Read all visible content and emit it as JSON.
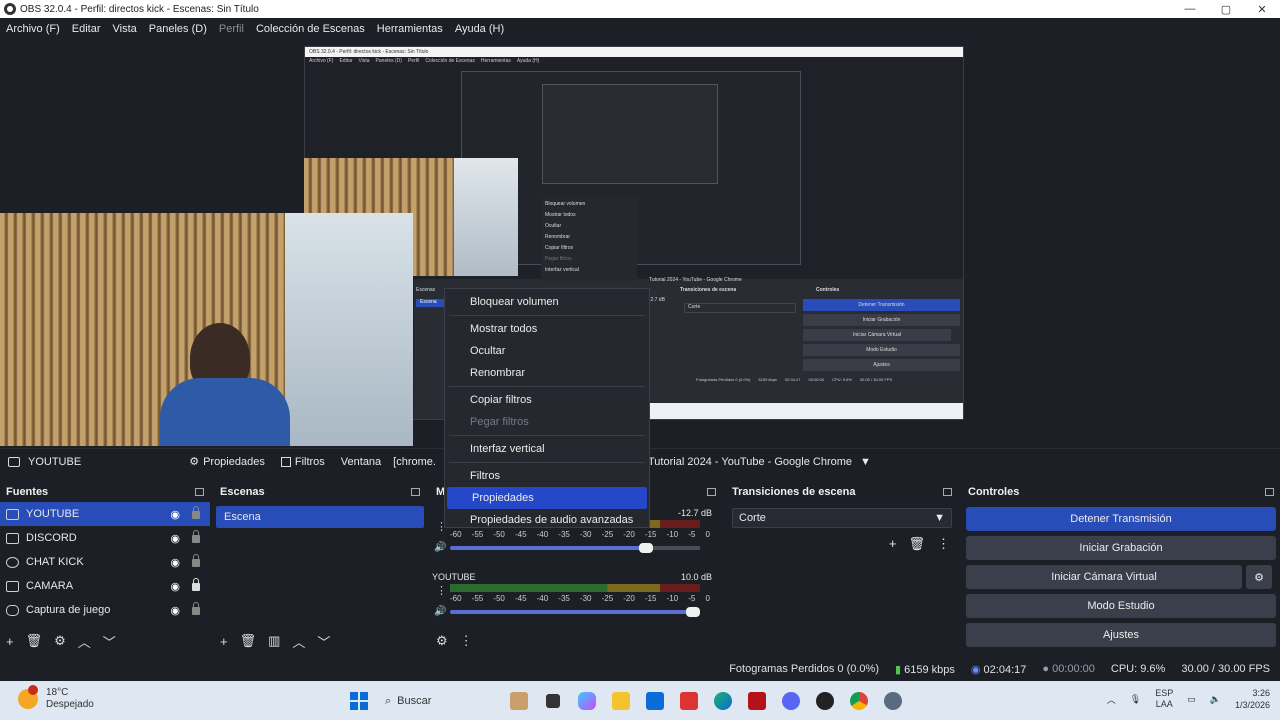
{
  "window": {
    "title": "OBS 32.0.4 - Perfil: directos kick - Escenas: Sin Título",
    "minimize": "—",
    "maximize": "▢",
    "close": "✕"
  },
  "menu": [
    "Archivo (F)",
    "Editar",
    "Vista",
    "Paneles (D)",
    "Perfil",
    "Colección de Escenas",
    "Herramientas",
    "Ayuda (H)"
  ],
  "nested_preview": {
    "title": "OBS 32.0.4 - Perfil: directos kick - Escenas: Sin Título",
    "menu": [
      "Archivo (F)",
      "Editar",
      "Vista",
      "Paneles (D)",
      "Perfil",
      "Colección de Escenas",
      "Herramientas",
      "Ayuda (H)"
    ],
    "context_items": [
      "Bloquear volumen",
      "Mostrar todos",
      "Ocultar",
      "Renombrar",
      "Copiar filtros",
      "Pegar filtros",
      "Interfaz vertical"
    ],
    "window_title": "Tutorial 2024 - YouTube - Google Chrome",
    "transitions_title": "Transiciones de escena",
    "controls_title": "Controles",
    "transition_value": "Corte",
    "scenes_title": "Escenas",
    "scene_item": "Escena",
    "meter_db": "-12.7 dB",
    "controls": [
      "Detener Transmisión",
      "Iniciar Grabación",
      "Iniciar Cámara Virtual",
      "Modo Estudio",
      "Ajustes"
    ],
    "status": [
      "Fotogramas Perdidos 0 (0.0%)",
      "6159 kbps",
      "02:04:17",
      "00:00:00",
      "CPU: 9.6%",
      "30.00 / 30.00 FPS"
    ]
  },
  "source_bar": {
    "source_name": "YOUTUBE",
    "properties": "Propiedades",
    "filters": "Filtros",
    "window_label": "Ventana",
    "window_value": "[chrome.exe]: Tutorial 2024 - YouTube - Google Chrome",
    "window_visible_prefix": "[chrome.",
    "window_visible_suffix": "Tutorial 2024 - YouTube - Google Chrome"
  },
  "docks": {
    "sources": {
      "title": "Fuentes",
      "items": [
        {
          "label": "YOUTUBE",
          "selected": true,
          "locked": false
        },
        {
          "label": "DISCORD",
          "selected": false,
          "locked": false
        },
        {
          "label": "CHAT KICK",
          "selected": false,
          "locked": false
        },
        {
          "label": "CAMARA",
          "selected": false,
          "locked": true
        },
        {
          "label": "Captura de juego",
          "selected": false,
          "locked": false
        }
      ]
    },
    "scenes": {
      "title": "Escenas",
      "items": [
        "Escena"
      ]
    },
    "mixer": {
      "title_visible": "M",
      "channels": [
        {
          "name": "",
          "db": "-12.7 dB",
          "level": 0.62,
          "volume": 0.8
        },
        {
          "name": "YOUTUBE",
          "db": "10.0 dB",
          "level": 0.0,
          "volume": 1.0
        }
      ],
      "ticks": [
        "-60",
        "-55",
        "-50",
        "-45",
        "-40",
        "-35",
        "-30",
        "-25",
        "-20",
        "-15",
        "-10",
        "-5",
        "0"
      ]
    },
    "transitions": {
      "title": "Transiciones de escena",
      "value": "Corte"
    },
    "controls": {
      "title": "Controles",
      "buttons": [
        "Detener Transmisión",
        "Iniciar Grabación",
        "Iniciar Cámara Virtual",
        "Modo Estudio",
        "Ajustes"
      ]
    }
  },
  "context_menu": {
    "items": [
      {
        "label": "Bloquear volumen",
        "disabled": false,
        "highlighted": false,
        "sep_after": true
      },
      {
        "label": "Mostrar todos",
        "disabled": false,
        "highlighted": false,
        "sep_after": false
      },
      {
        "label": "Ocultar",
        "disabled": false,
        "highlighted": false,
        "sep_after": false
      },
      {
        "label": "Renombrar",
        "disabled": false,
        "highlighted": false,
        "sep_after": true
      },
      {
        "label": "Copiar filtros",
        "disabled": false,
        "highlighted": false,
        "sep_after": false
      },
      {
        "label": "Pegar filtros",
        "disabled": true,
        "highlighted": false,
        "sep_after": true
      },
      {
        "label": "Interfaz vertical",
        "disabled": false,
        "highlighted": false,
        "sep_after": true
      },
      {
        "label": "Filtros",
        "disabled": false,
        "highlighted": false,
        "sep_after": false
      },
      {
        "label": "Propiedades",
        "disabled": false,
        "highlighted": true,
        "sep_after": false
      },
      {
        "label": "Propiedades de audio avanzadas",
        "disabled": false,
        "highlighted": false,
        "sep_after": false
      }
    ]
  },
  "status": {
    "dropped": "Fotogramas Perdidos 0 (0.0%)",
    "bitrate": "6159 kbps",
    "stream_time": "02:04:17",
    "rec_time": "00:00:00",
    "cpu": "CPU: 9.6%",
    "fps": "30.00 / 30.00 FPS"
  },
  "taskbar": {
    "temperature": "18°C",
    "weather": "Despejado",
    "search_placeholder": "Buscar",
    "lang_top": "ESP",
    "lang_bottom": "LAA",
    "time": "3:26",
    "date": "1/3/2026",
    "icons": [
      "start-icon",
      "search-icon",
      "widget-icon",
      "file-explorer-icon",
      "copilot-icon",
      "folder-icon",
      "store-icon",
      "app-red-icon",
      "edge-icon",
      "acrobat-icon",
      "discord-icon",
      "obs-icon",
      "chrome-icon",
      "settings-icon"
    ]
  },
  "colors": {
    "accent": "#284cb8",
    "highlight": "#2548c8",
    "panel": "#272a33",
    "background": "#1d1f26"
  }
}
